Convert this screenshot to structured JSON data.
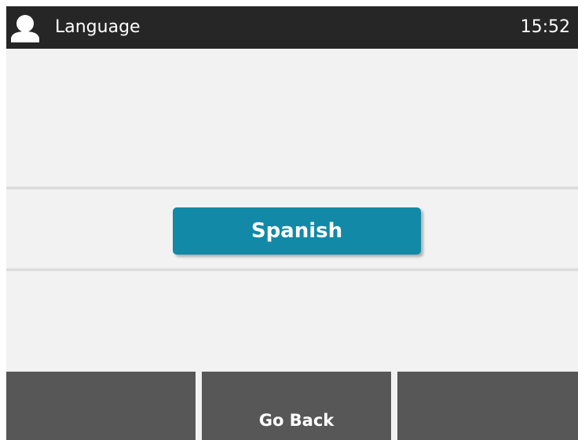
{
  "header": {
    "title": "Language",
    "time": "15:52",
    "icon": "user-icon"
  },
  "main": {
    "selected_option": "Spanish",
    "accent_color": "#1289a7"
  },
  "softkeys": [
    {
      "label": ""
    },
    {
      "label": "Go Back"
    },
    {
      "label": ""
    }
  ]
}
